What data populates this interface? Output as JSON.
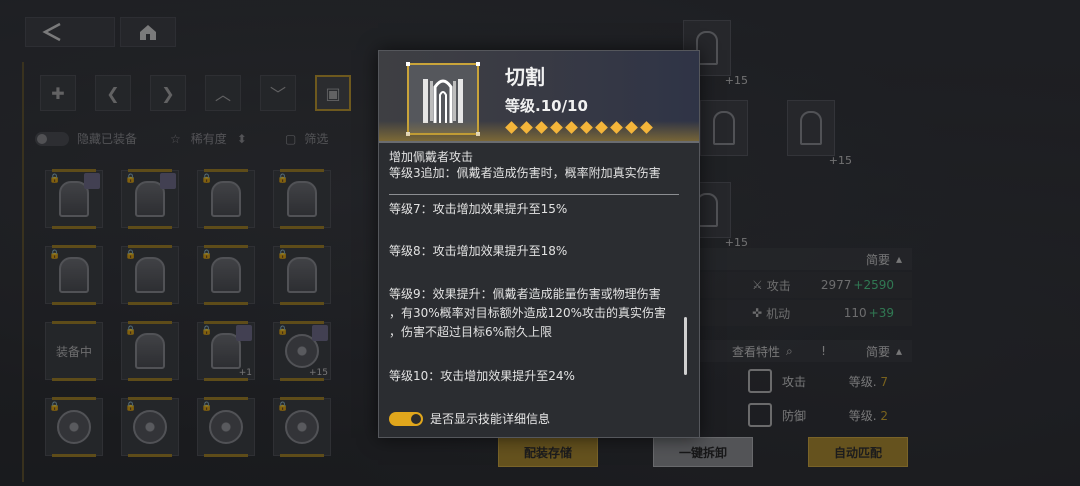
{
  "nav": {
    "back_icon": "chevron-left-icon",
    "home_icon": "home-icon"
  },
  "left_panel": {
    "hide_equipped_label": "隐藏已装备",
    "sort_label": "稀有度",
    "filter_label": "筛选",
    "equipped_label": "装备中",
    "upgrade_badges": [
      "+1",
      "+15"
    ]
  },
  "background_badges": [
    "+15",
    "+15",
    "+15"
  ],
  "stats": {
    "summary_label": "简要",
    "rows": [
      {
        "name": "攻击",
        "value": "2977",
        "bonus": "+2590"
      },
      {
        "name": "机动",
        "value": "110",
        "bonus": "+39"
      }
    ],
    "traits_header": "查看特性",
    "traits_summary_label": "简要",
    "traits": [
      {
        "name": "攻击",
        "level_label": "等级.",
        "level": "7"
      },
      {
        "name": "防御",
        "level_label": "等级.",
        "level": "2"
      }
    ]
  },
  "bottom_buttons": {
    "save_label": "配装存储",
    "remove_all_label": "一键拆卸",
    "auto_match_label": "自动匹配"
  },
  "popup": {
    "title": "切割",
    "level_text": "等级.10/10",
    "level": 10,
    "max_level": 10,
    "intro_lines": [
      "增加佩戴者攻击",
      "等级3追加：佩戴者造成伤害时，概率附加真实伤害"
    ],
    "level_entries": [
      {
        "lines": [
          "等级7：攻击增加效果提升至15%"
        ]
      },
      {
        "lines": [
          "等级8：攻击增加效果提升至18%"
        ]
      },
      {
        "lines": [
          "等级9：效果提升：佩戴者造成能量伤害或物理伤害",
          "，有30%概率对目标额外造成120%攻击的真实伤害",
          "，伤害不超过目标6%耐久上限"
        ]
      },
      {
        "lines": [
          "等级10：攻击增加效果提升至24%"
        ]
      }
    ],
    "show_details_label": "是否显示技能详细信息",
    "show_details_enabled": true
  },
  "colors": {
    "accent_gold": "#c9a43a",
    "diamond": "#f4b53a",
    "bonus_green": "#4fd18b",
    "toggle_on": "#e0a61c"
  }
}
